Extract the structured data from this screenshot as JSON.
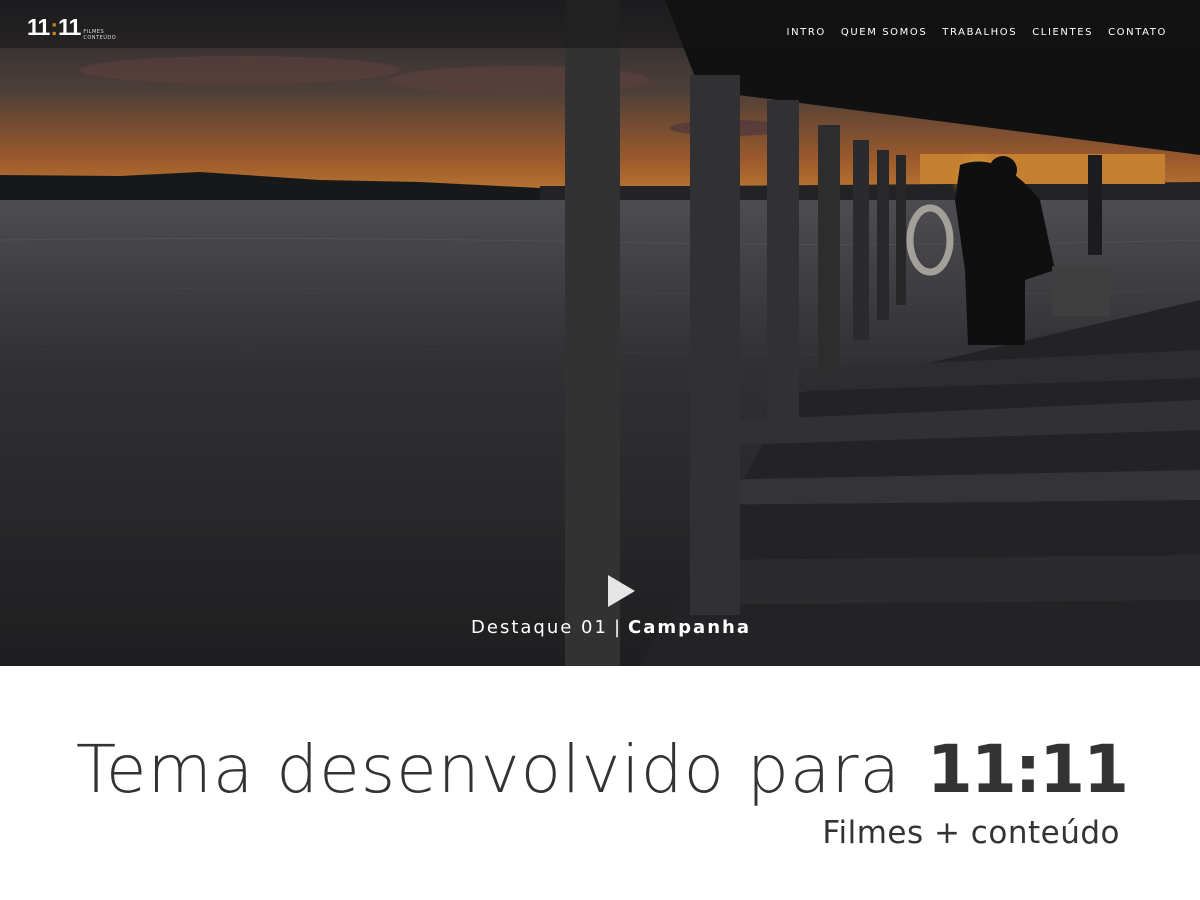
{
  "logo": {
    "number_left": "11",
    "colon": ":",
    "number_right": "11",
    "sub_line1": "FILMES",
    "sub_line2": "CONTEÚDO"
  },
  "nav": {
    "items": [
      {
        "label": "INTRO"
      },
      {
        "label": "QUEM SOMOS"
      },
      {
        "label": "TRABALHOS"
      },
      {
        "label": "CLIENTES"
      },
      {
        "label": "CONTATO"
      }
    ]
  },
  "hero": {
    "play_icon": "play-icon",
    "caption_prefix": "Destaque 01",
    "caption_separator": "|",
    "caption_category": "Campanha"
  },
  "promo": {
    "title_text": "Tema desenvolvido para",
    "title_brand": "11:11",
    "subtitle": "Filmes + conteúdo"
  },
  "colors": {
    "accent": "#c9841a",
    "text_dark": "#333333",
    "nav_text": "#ffffff"
  }
}
